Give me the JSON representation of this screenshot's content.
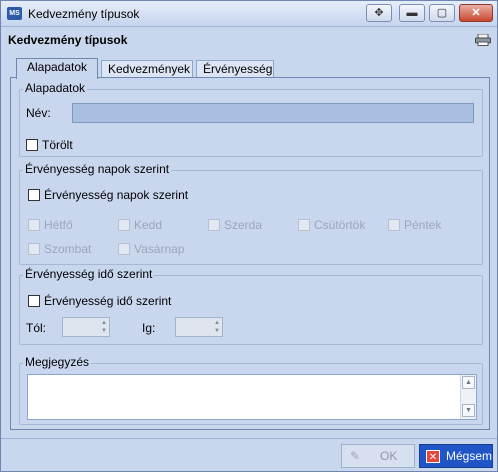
{
  "window": {
    "app_icon": "MS",
    "title": "Kedvezmény típusok",
    "move_icon": "✥",
    "minimize_icon": "▬",
    "maximize_icon": "▢",
    "close_icon": "✕"
  },
  "header": {
    "title": "Kedvezmény típusok",
    "print_icon": "printer-icon"
  },
  "tabs": [
    {
      "label": "Alapadatok",
      "active": true
    },
    {
      "label": "Kedvezmények",
      "active": false
    },
    {
      "label": "Érvényesség",
      "active": false
    }
  ],
  "basic": {
    "legend": "Alapadatok",
    "name_label": "Név:",
    "name_value": "",
    "deleted_label": "Törölt",
    "deleted_checked": false
  },
  "days": {
    "legend": "Érvényesség napok szerint",
    "enable_label": "Érvényesség napok szerint",
    "enable_checked": false,
    "items": [
      "Hétfő",
      "Kedd",
      "Szerda",
      "Csütörtök",
      "Péntek",
      "Szombat",
      "Vasárnap"
    ]
  },
  "time": {
    "legend": "Érvényesség idő szerint",
    "enable_label": "Érvényesség idő szerint",
    "enable_checked": false,
    "from_label": "Tól:",
    "to_label": "Ig:",
    "spin_up": "▲",
    "spin_down": "▼"
  },
  "notes": {
    "legend": "Megjegyzés",
    "value": "",
    "scroll_up": "▲",
    "scroll_down": "▼"
  },
  "footer": {
    "ok_label": "OK",
    "ok_icon": "✎",
    "cancel_label": "Mégsem",
    "cancel_icon": "✕"
  }
}
